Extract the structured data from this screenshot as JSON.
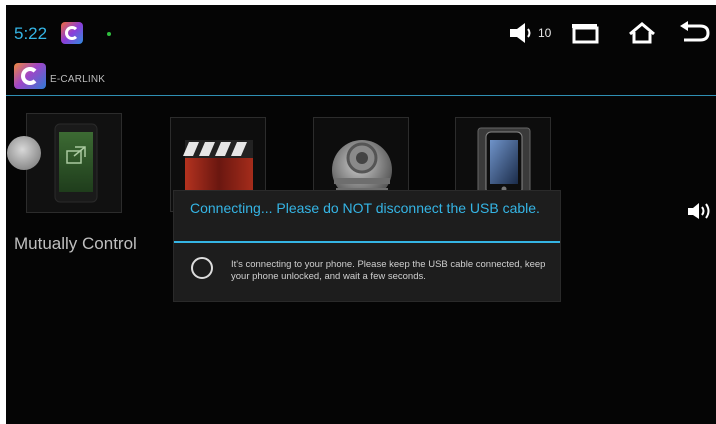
{
  "status_bar": {
    "time": "5:22",
    "volume_level": "10",
    "icons": [
      "e-carlink-notification-icon",
      "volume-icon",
      "recent-apps-icon",
      "home-icon",
      "back-icon"
    ],
    "accent_color": "#35b5e5"
  },
  "app_header": {
    "name": "E-CARLINK"
  },
  "tiles": [
    {
      "label": "Mutually Control",
      "icon": "mutually-control-icon"
    },
    {
      "label": "",
      "icon": "video-clapper-icon"
    },
    {
      "label": "",
      "icon": "settings-gear-icon"
    },
    {
      "label": "",
      "icon": "phone-icon"
    }
  ],
  "dialog": {
    "title": "Connecting... Please do NOT disconnect the USB cable.",
    "message": "It's connecting to your phone. Please keep the USB cable connected, keep your phone unlocked, and wait a few seconds."
  }
}
